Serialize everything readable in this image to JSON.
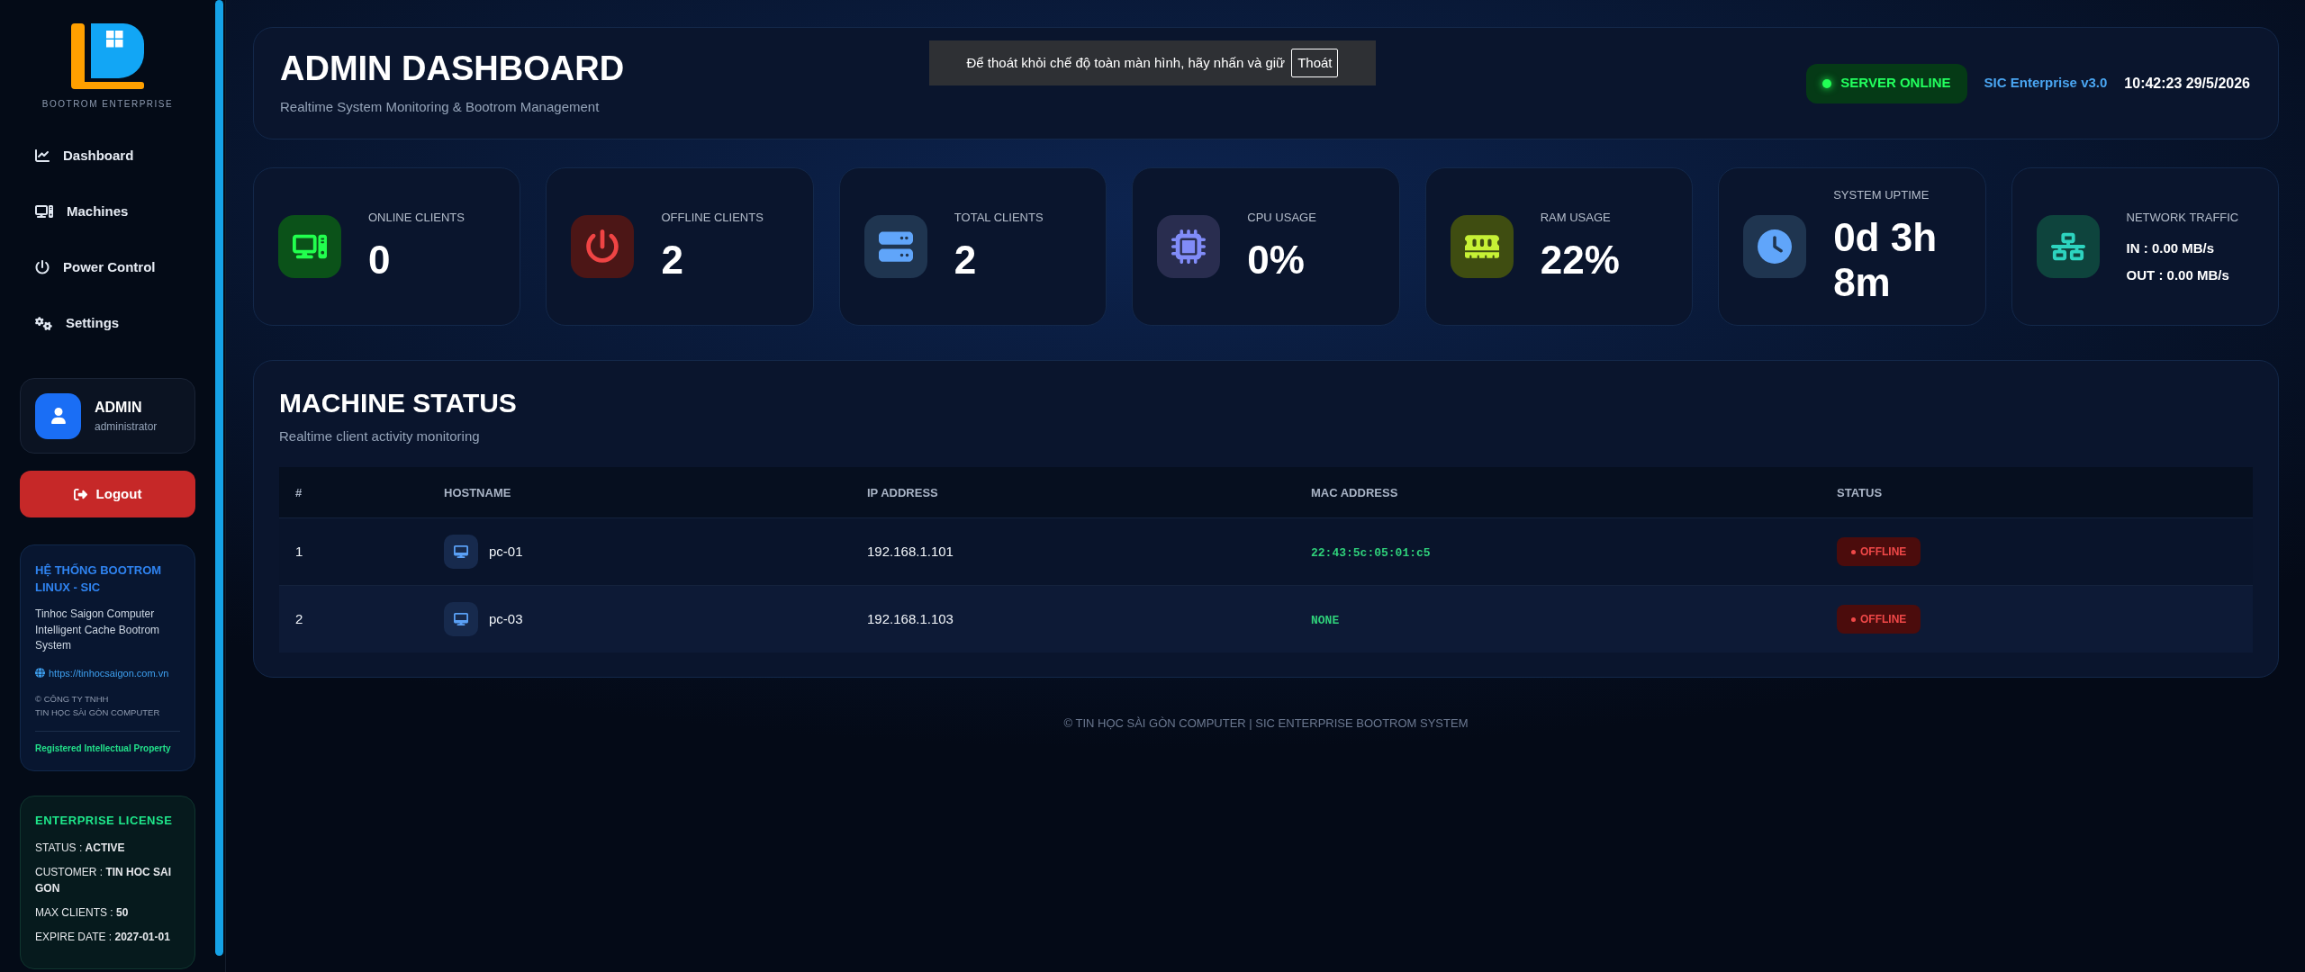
{
  "sidebar": {
    "brand": "BOOTROM ENTERPRISE",
    "nav": [
      {
        "label": "Dashboard"
      },
      {
        "label": "Machines"
      },
      {
        "label": "Power Control"
      },
      {
        "label": "Settings"
      }
    ],
    "user": {
      "name": "ADMIN",
      "role": "administrator"
    },
    "logout": "Logout",
    "info": {
      "title": "HỆ THỐNG BOOTROM LINUX - SIC",
      "description": "Tinhoc Saigon Computer Intelligent Cache Bootrom System",
      "link": "https://tinhocsaigon.com.vn",
      "copyright": [
        "© CÔNG TY TNHH",
        "TIN HỌC SÀI GÒN COMPUTER"
      ],
      "badge": "Registered Intellectual Property"
    },
    "license": {
      "title": "ENTERPRISE LICENSE",
      "rows": [
        "STATUS : **ACTIVE**",
        "CUSTOMER : **TIN HOC SAI GON**",
        "MAX CLIENTS : **50**",
        "EXPIRE DATE : **2027-01-01**"
      ]
    }
  },
  "header": {
    "title": "ADMIN DASHBOARD",
    "subtitle": "Realtime System Monitoring & Bootrom Management",
    "server_status": {
      "label": "SERVER ONLINE",
      "online": true
    },
    "version": "SIC Enterprise v3.0",
    "datetime": "10:42:23 29/5/2026"
  },
  "fullscreen_notice": {
    "message": "Để thoát khỏi chế độ toàn màn hình, hãy nhấn và giữ",
    "key": "Thoát"
  },
  "stats": [
    {
      "kind": "value",
      "label": "ONLINE CLIENTS",
      "value": "0",
      "color": "#22ff4e"
    },
    {
      "kind": "value",
      "label": "OFFLINE CLIENTS",
      "value": "2",
      "color": "#ef4444"
    },
    {
      "kind": "value",
      "label": "TOTAL CLIENTS",
      "value": "2",
      "color": "#60a5fa"
    },
    {
      "kind": "value",
      "label": "CPU USAGE",
      "value": "0%",
      "color": "#818cf8"
    },
    {
      "kind": "value",
      "label": "RAM USAGE",
      "value": "22%",
      "color": "#c6f135"
    },
    {
      "kind": "value",
      "label": "SYSTEM UPTIME",
      "value": "0d 3h 8m",
      "color": "#60a5fa"
    },
    {
      "kind": "lines",
      "label": "NETWORK TRAFFIC",
      "lines": [
        "IN : 0.00 MB/s",
        "OUT : 0.00 MB/s"
      ],
      "color": "#2dd4bf"
    }
  ],
  "machine_status": {
    "title": "MACHINE STATUS",
    "subtitle": "Realtime client activity monitoring",
    "table": {
      "columns": [
        "#",
        "HOSTNAME",
        "IP ADDRESS",
        "MAC ADDRESS",
        "STATUS"
      ],
      "rows": [
        {
          "index": "1",
          "hostname": "pc-01",
          "ip": "192.168.1.101",
          "mac": "22:43:5c:05:01:c5",
          "status": "OFFLINE",
          "online": false
        },
        {
          "index": "2",
          "hostname": "pc-03",
          "ip": "192.168.1.103",
          "mac": "NONE",
          "status": "OFFLINE",
          "online": false
        }
      ]
    }
  },
  "footer": "© TIN HỌC SÀI GÒN COMPUTER | SIC ENTERPRISE BOOTROM SYSTEM"
}
